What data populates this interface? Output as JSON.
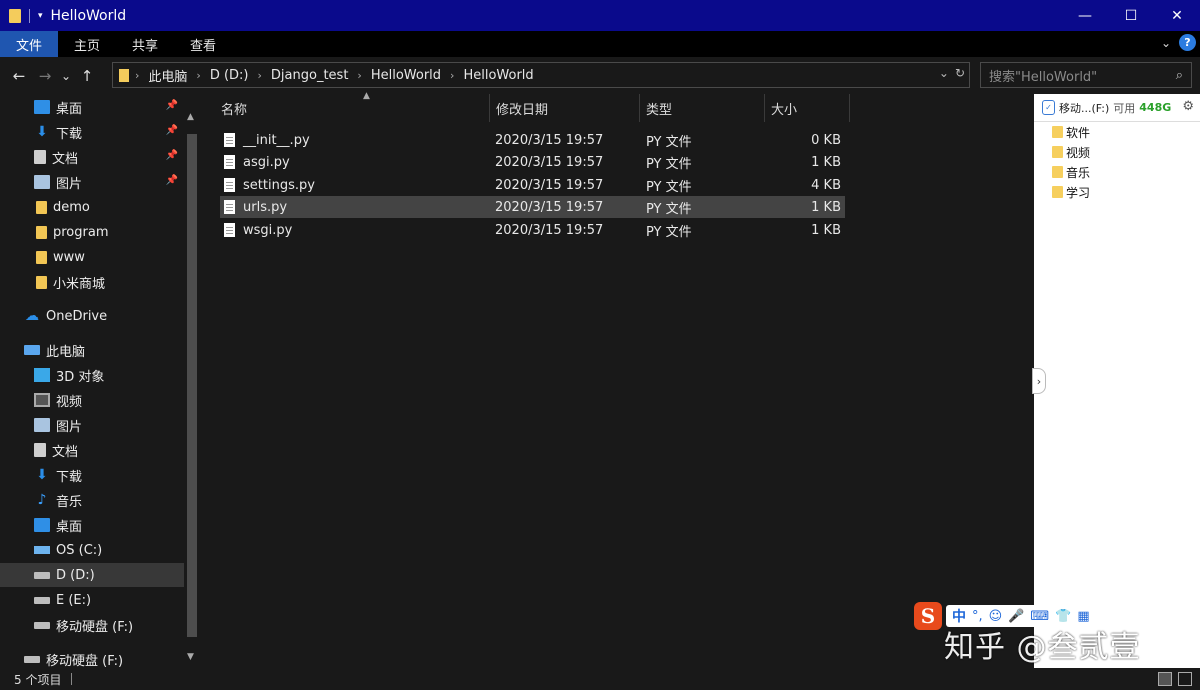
{
  "window": {
    "title": "HelloWorld",
    "controls": {
      "minimize": "—",
      "maximize": "☐",
      "close": "✕"
    }
  },
  "ribbon": {
    "tabs": [
      "文件",
      "主页",
      "共享",
      "查看"
    ],
    "help": "?"
  },
  "nav": {
    "back": "←",
    "forward": "→",
    "recent": "⌄",
    "up": "↑",
    "breadcrumbs": [
      "此电脑",
      "D (D:)",
      "Django_test",
      "HelloWorld",
      "HelloWorld"
    ],
    "search_placeholder": "搜索\"HelloWorld\""
  },
  "sidebar": {
    "quick_access": [
      {
        "label": "桌面",
        "icon": "desktop-icon",
        "pinned": true
      },
      {
        "label": "下载",
        "icon": "download-icon",
        "pinned": true
      },
      {
        "label": "文档",
        "icon": "document-icon",
        "pinned": true
      },
      {
        "label": "图片",
        "icon": "picture-icon",
        "pinned": true
      },
      {
        "label": "demo",
        "icon": "folder-icon",
        "pinned": false
      },
      {
        "label": "program",
        "icon": "folder-icon",
        "pinned": false
      },
      {
        "label": "www",
        "icon": "folder-icon",
        "pinned": false
      },
      {
        "label": "小米商城",
        "icon": "folder-icon",
        "pinned": false
      }
    ],
    "onedrive": "OneDrive",
    "this_pc": "此电脑",
    "pc_items": [
      {
        "label": "3D 对象",
        "icon": "3d-objects-icon"
      },
      {
        "label": "视频",
        "icon": "video-icon"
      },
      {
        "label": "图片",
        "icon": "picture-icon"
      },
      {
        "label": "文档",
        "icon": "document-icon"
      },
      {
        "label": "下载",
        "icon": "download-icon"
      },
      {
        "label": "音乐",
        "icon": "music-icon"
      },
      {
        "label": "桌面",
        "icon": "desktop-icon"
      },
      {
        "label": "OS (C:)",
        "icon": "os-drive-icon"
      },
      {
        "label": "D (D:)",
        "icon": "drive-icon"
      },
      {
        "label": "E (E:)",
        "icon": "drive-icon"
      },
      {
        "label": "移动硬盘 (F:)",
        "icon": "drive-icon"
      }
    ],
    "removable": "移动硬盘 (F:)"
  },
  "filelist": {
    "columns": {
      "name": "名称",
      "modified": "修改日期",
      "type": "类型",
      "size": "大小"
    },
    "rows": [
      {
        "name": "__init__.py",
        "modified": "2020/3/15 19:57",
        "type": "PY 文件",
        "size": "0 KB"
      },
      {
        "name": "asgi.py",
        "modified": "2020/3/15 19:57",
        "type": "PY 文件",
        "size": "1 KB"
      },
      {
        "name": "settings.py",
        "modified": "2020/3/15 19:57",
        "type": "PY 文件",
        "size": "4 KB"
      },
      {
        "name": "urls.py",
        "modified": "2020/3/15 19:57",
        "type": "PY 文件",
        "size": "1 KB"
      },
      {
        "name": "wsgi.py",
        "modified": "2020/3/15 19:57",
        "type": "PY 文件",
        "size": "1 KB"
      }
    ]
  },
  "rightpane": {
    "drive": "移动...(F:)",
    "free_label": "可用",
    "free_size": "448G",
    "folders": [
      "软件",
      "视频",
      "音乐",
      "学习"
    ]
  },
  "ime": {
    "mode": "中",
    "punct": "°,"
  },
  "watermark": "知乎 @叁贰壹",
  "status": {
    "count": "5 个项目"
  },
  "colors": {
    "titlebar": "#0a0a8c",
    "accent": "#1f56b0",
    "background": "#191919",
    "selection": "#444444"
  }
}
